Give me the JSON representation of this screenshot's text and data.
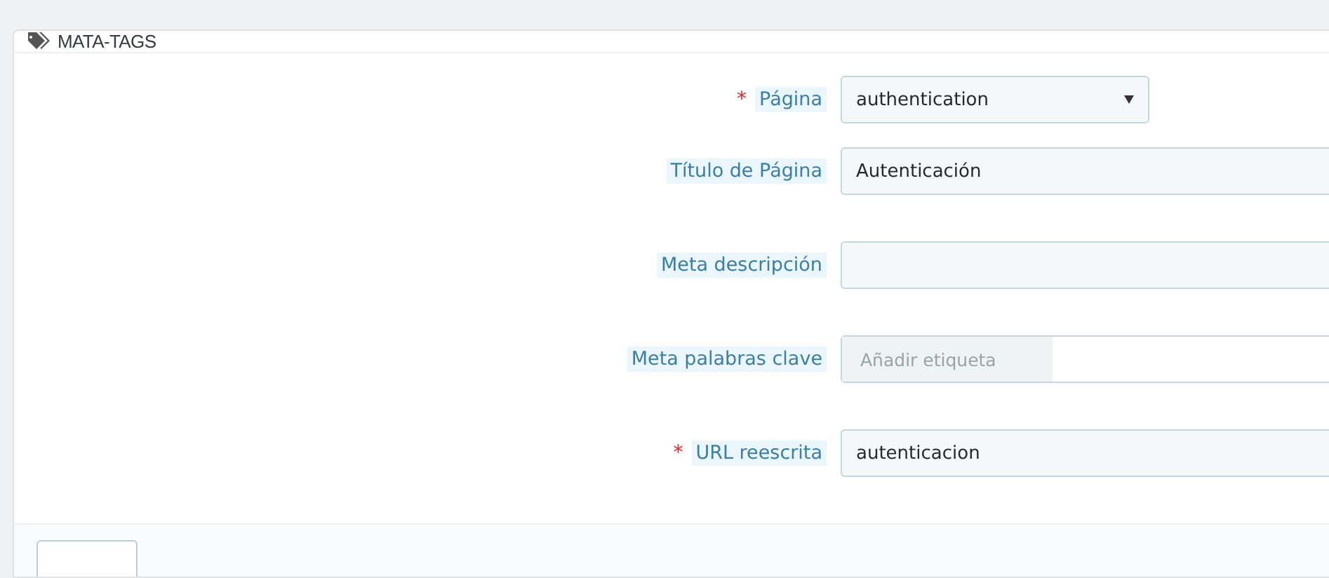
{
  "panel": {
    "title": "MATA-TAGS"
  },
  "required_mark": "*",
  "fields": [
    {
      "label": "Página",
      "required": true,
      "kind": "select",
      "value": "authentication"
    },
    {
      "label": "Título de Página",
      "required": false,
      "kind": "text",
      "value": "Autenticación"
    },
    {
      "label": "Meta descripción",
      "required": false,
      "kind": "text"
    },
    {
      "label": "Meta palabras clave",
      "required": false,
      "kind": "tags",
      "placeholder": "Añadir etiqueta"
    },
    {
      "label": "URL reescrita",
      "required": true,
      "kind": "text",
      "value": "autenticacion"
    }
  ]
}
